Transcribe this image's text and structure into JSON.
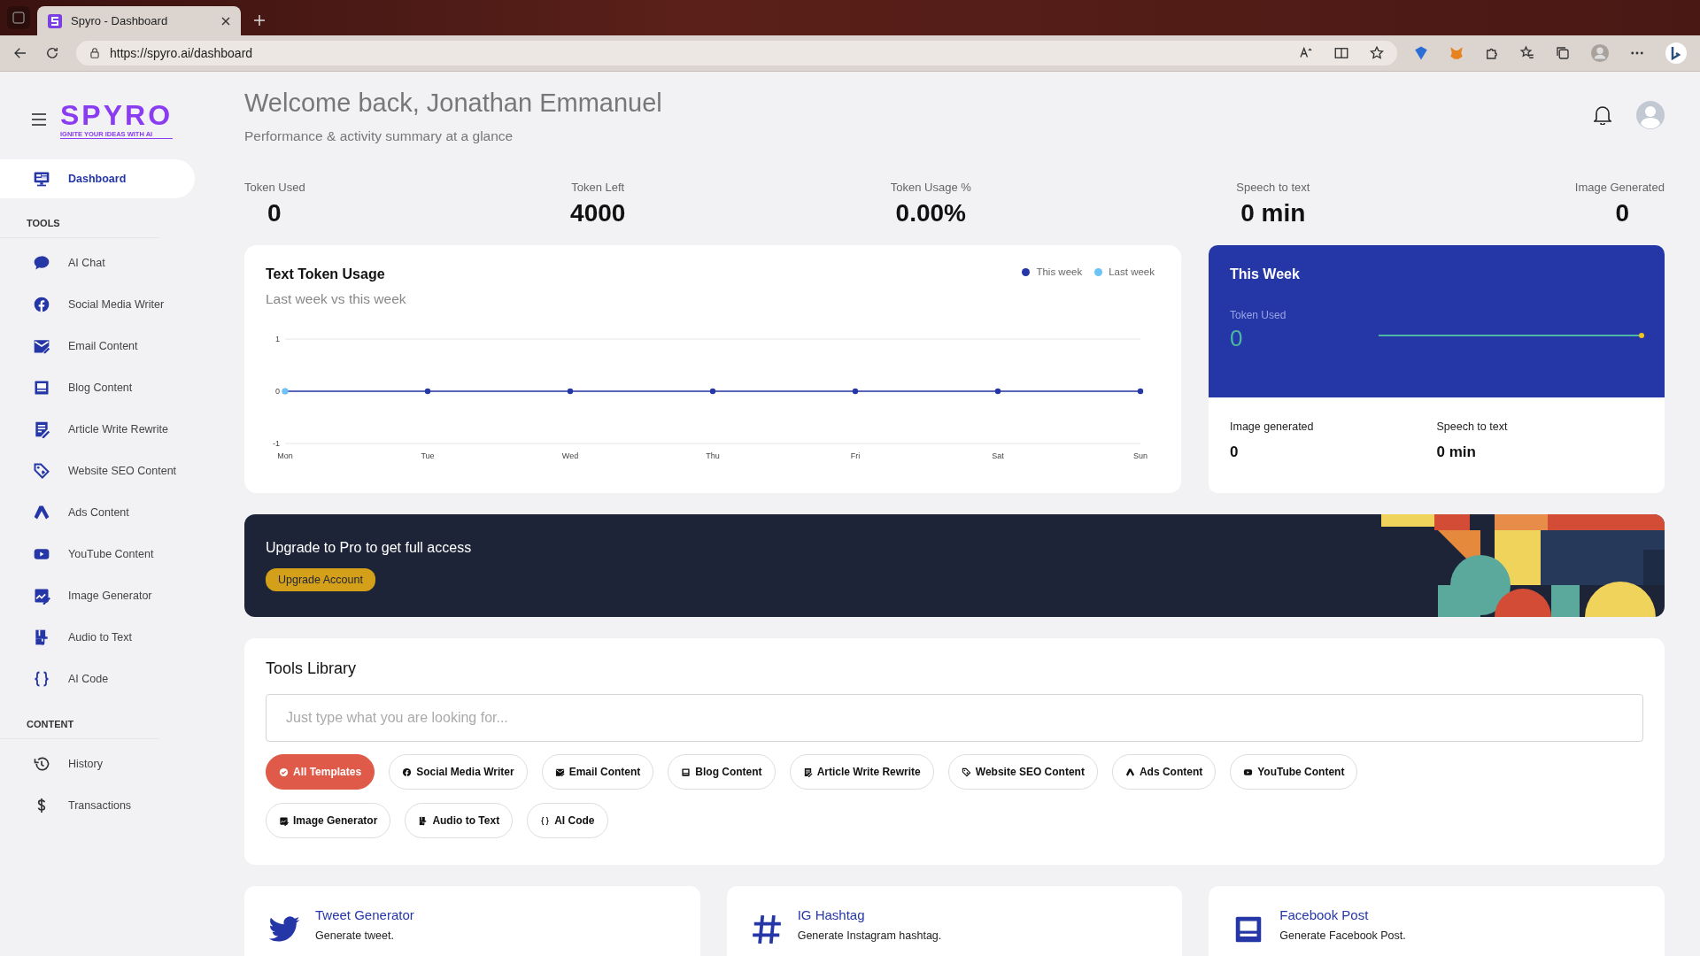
{
  "browser": {
    "tab_title": "Spyro - Dashboard",
    "url": "https://spyro.ai/dashboard"
  },
  "sidebar": {
    "logo": "SPYRO",
    "tagline": "IGNITE YOUR IDEAS WITH AI",
    "nav": [
      {
        "label": "Dashboard",
        "selected": true
      }
    ],
    "sections": [
      {
        "title": "TOOLS",
        "items": [
          {
            "label": "AI Chat",
            "selected": false
          },
          {
            "label": "Social Media Writer",
            "selected": false
          },
          {
            "label": "Email Content",
            "selected": false
          },
          {
            "label": "Blog Content",
            "selected": false
          },
          {
            "label": "Article Write Rewrite",
            "selected": false
          },
          {
            "label": "Website SEO Content",
            "selected": false
          },
          {
            "label": "Ads Content",
            "selected": false
          },
          {
            "label": "YouTube Content",
            "selected": false
          },
          {
            "label": "Image Generator",
            "selected": false
          },
          {
            "label": "Audio to Text",
            "selected": false
          },
          {
            "label": "AI Code",
            "selected": false
          }
        ]
      },
      {
        "title": "CONTENT",
        "items": [
          {
            "label": "History",
            "selected": false
          },
          {
            "label": "Transactions",
            "selected": false
          }
        ]
      }
    ]
  },
  "header": {
    "title": "Welcome back, Jonathan Emmanuel",
    "subtitle": "Performance & activity summary at a glance"
  },
  "stats": [
    {
      "label": "Token Used",
      "value": "0"
    },
    {
      "label": "Token Left",
      "value": "4000"
    },
    {
      "label": "Token Usage %",
      "value": "0.00%"
    },
    {
      "label": "Speech to text",
      "value": "0 min"
    },
    {
      "label": "Image Generated",
      "value": "0"
    }
  ],
  "usage_card": {
    "title": "Text Token Usage",
    "subtitle": "Last week vs this week",
    "chart_data": {
      "type": "line",
      "categories": [
        "Mon",
        "Tue",
        "Wed",
        "Thu",
        "Fri",
        "Sat",
        "Sun"
      ],
      "ylim": [
        -1,
        1
      ],
      "yticks": [
        -1,
        0,
        1
      ],
      "series": [
        {
          "name": "This week",
          "color": "#2536a7",
          "marker": true,
          "values": [
            0,
            0,
            0,
            0,
            0,
            0,
            0
          ]
        },
        {
          "name": "Last week",
          "color": "#6cc3f7",
          "marker": true,
          "values": [
            0,
            null,
            null,
            null,
            null,
            null,
            null
          ]
        }
      ]
    }
  },
  "week_card": {
    "title": "This Week",
    "metric_label": "Token Used",
    "metric_value": "0",
    "stats": [
      {
        "label": "Image generated",
        "value": "0"
      },
      {
        "label": "Speech to text",
        "value": "0 min"
      }
    ]
  },
  "banner": {
    "text": "Upgrade to Pro to get full access",
    "button": "Upgrade Account"
  },
  "tools_library": {
    "title": "Tools Library",
    "search": {
      "placeholder": "Just type what you are looking for..."
    },
    "filters": [
      {
        "label": "All Templates",
        "selected": true
      },
      {
        "label": "Social Media Writer",
        "selected": false
      },
      {
        "label": "Email Content",
        "selected": false
      },
      {
        "label": "Blog Content",
        "selected": false
      },
      {
        "label": "Article Write Rewrite",
        "selected": false
      },
      {
        "label": "Website SEO Content",
        "selected": false
      },
      {
        "label": "Ads Content",
        "selected": false
      },
      {
        "label": "YouTube Content",
        "selected": false
      },
      {
        "label": "Image Generator",
        "selected": false
      },
      {
        "label": "Audio to Text",
        "selected": false
      },
      {
        "label": "AI Code",
        "selected": false
      }
    ]
  },
  "tool_cards": [
    {
      "title": "Tweet Generator",
      "description": "Generate tweet."
    },
    {
      "title": "IG Hashtag",
      "description": "Generate Instagram hashtag."
    },
    {
      "title": "Facebook Post",
      "description": "Generate Facebook Post."
    }
  ]
}
